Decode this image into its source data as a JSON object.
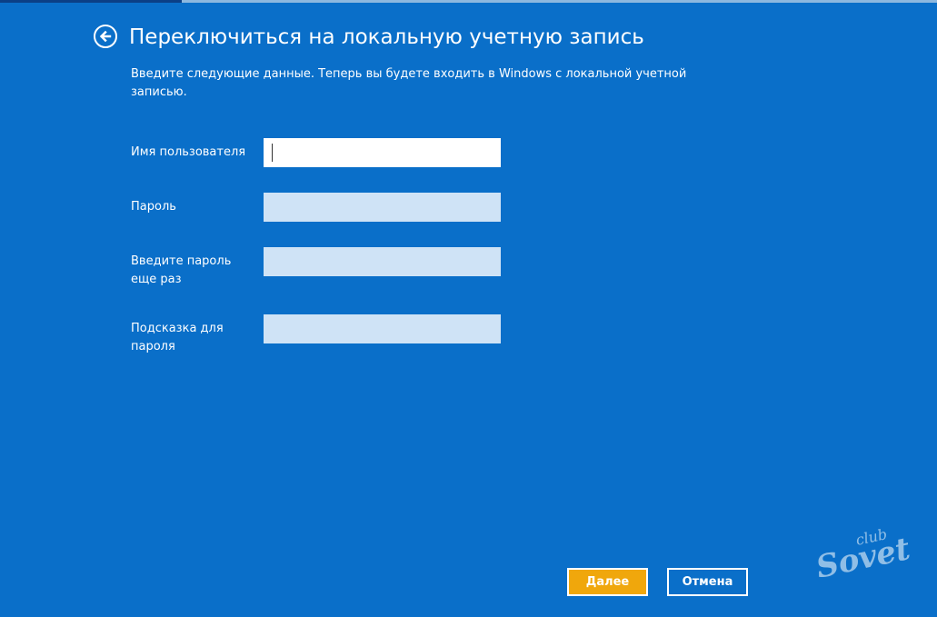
{
  "header": {
    "title": "Переключиться на локальную учетную запись",
    "subtitle": "Введите следующие данные. Теперь вы будете входить в Windows с локальной учетной записью."
  },
  "form": {
    "username_label": "Имя пользователя",
    "username_value": "",
    "password_label": "Пароль",
    "password_value": "",
    "confirm_label": "Введите пароль еще раз",
    "confirm_value": "",
    "hint_label": "Подсказка для пароля",
    "hint_value": ""
  },
  "actions": {
    "next_label": "Далее",
    "cancel_label": "Отмена"
  },
  "watermark": {
    "text_top": "club",
    "text_main": "Sovet"
  },
  "icons": {
    "back": "arrow-left-circle-icon"
  },
  "colors": {
    "background": "#0a6fc9",
    "accent_button": "#f0a70c",
    "inactive_field": "#cfe3f6"
  }
}
